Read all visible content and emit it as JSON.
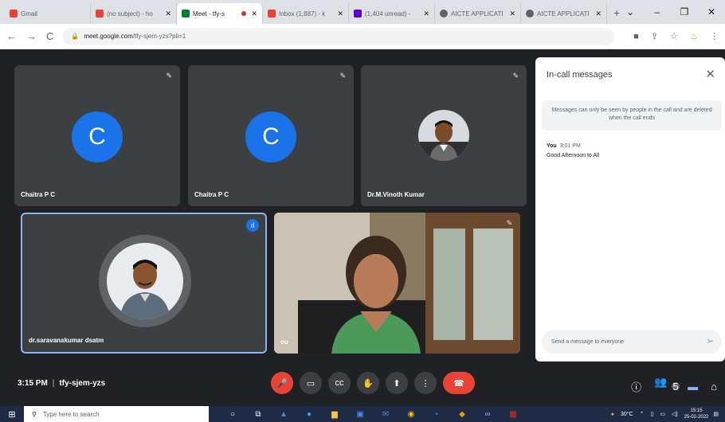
{
  "browser": {
    "tabs": [
      {
        "title": "Gmail",
        "color": "#ea4335",
        "active": false
      },
      {
        "title": "(no subject) - ho",
        "color": "#ea4335",
        "active": false
      },
      {
        "title": "Meet - tfy-s",
        "color": "#00832d",
        "active": true,
        "recording": true
      },
      {
        "title": "Inbox (1,887) - k",
        "color": "#ea4335",
        "active": false
      },
      {
        "title": "(1,404 unread) -",
        "color": "#6001d2",
        "active": false
      },
      {
        "title": "AICTE APPLICATI",
        "color": "#5f6368",
        "active": false
      },
      {
        "title": "AICTE APPLICATI",
        "color": "#5f6368",
        "active": false
      }
    ],
    "url_host": "meet.google.com",
    "url_path": "/tfy-sjem-yzs?pli=1"
  },
  "participants": {
    "p1": {
      "name": "Chaitra P C",
      "initial": "C"
    },
    "p2": {
      "name": "Chaitra P C",
      "initial": "C"
    },
    "p3": {
      "name": "Dr.M.Vinoth Kumar"
    },
    "p4": {
      "name": "dr.saravanakumar dsatm"
    },
    "p5": {
      "name": "ou"
    }
  },
  "chat": {
    "title": "In-call messages",
    "note": "Messages can only be seen by people in the call and are deleted when the call ends",
    "sender": "You",
    "time": "3:01 PM",
    "message": "Good Afternoon to All",
    "placeholder": "Send a message to everyone"
  },
  "meeting": {
    "time": "3:15 PM",
    "separator": "|",
    "code": "tfy-sjem-yzs",
    "people_count": "5"
  },
  "taskbar": {
    "search_placeholder": "Type here to search",
    "weather": "30°C",
    "time": "15:15",
    "date": "25-02-2022"
  }
}
